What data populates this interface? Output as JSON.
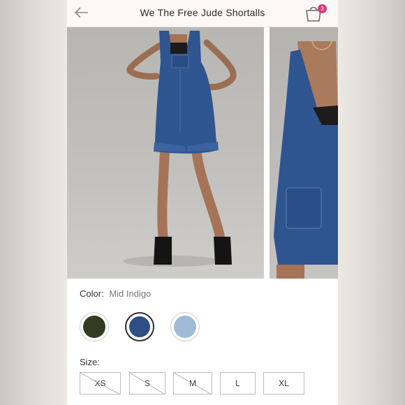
{
  "header": {
    "title": "We The Free Jude Shortalls",
    "back_icon": "back-arrow-icon",
    "bag_icon": "shopping-bag-icon",
    "bag_count": "3"
  },
  "product": {
    "images": [
      "front-view",
      "back-view"
    ],
    "color_label": "Color:",
    "color_value": "Mid Indigo",
    "swatches": [
      {
        "name": "olive",
        "color": "#353a23",
        "selected": false
      },
      {
        "name": "mid-indigo",
        "color": "#2e4e86",
        "selected": true
      },
      {
        "name": "light-wash",
        "color": "#9fbbd6",
        "selected": false
      }
    ],
    "size_label": "Size:",
    "sizes": [
      {
        "label": "XS",
        "available": false
      },
      {
        "label": "S",
        "available": false
      },
      {
        "label": "M",
        "available": false
      },
      {
        "label": "L",
        "available": true
      },
      {
        "label": "XL",
        "available": true
      }
    ]
  },
  "colors": {
    "badge": "#d63a79",
    "header_bg": "#fbf8f6"
  }
}
